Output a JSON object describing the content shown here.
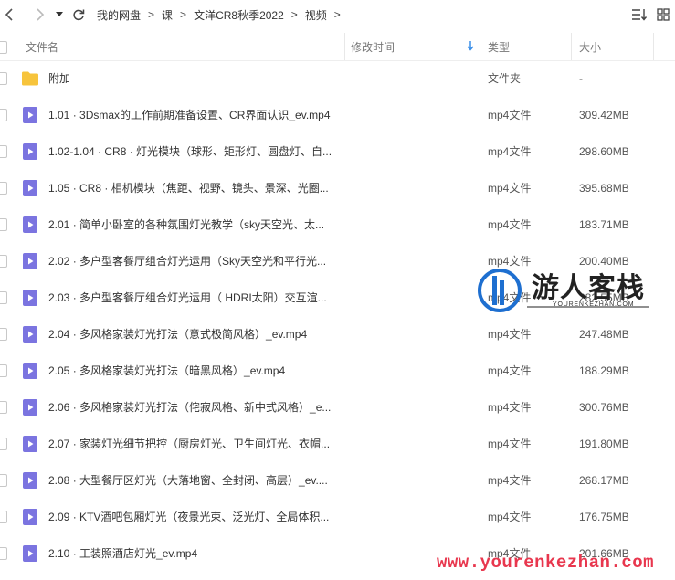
{
  "breadcrumb": [
    "我的网盘",
    "课",
    "文洋CR8秋季2022",
    "视频"
  ],
  "breadcrumb_sep": ">",
  "columns": {
    "name": "文件名",
    "modified": "修改时间",
    "type": "类型",
    "size": "大小"
  },
  "files": [
    {
      "name": "附加",
      "type": "文件夹",
      "size": "-",
      "kind": "folder"
    },
    {
      "name": "1.01 · 3Dsmax的工作前期准备设置、CR界面认识_ev.mp4",
      "type": "mp4文件",
      "size": "309.42MB",
      "kind": "video"
    },
    {
      "name": "1.02-1.04 · CR8 · 灯光模块（球形、矩形灯、圆盘灯、自...",
      "type": "mp4文件",
      "size": "298.60MB",
      "kind": "video"
    },
    {
      "name": "1.05 · CR8 · 相机模块（焦距、视野、镜头、景深、光圈...",
      "type": "mp4文件",
      "size": "395.68MB",
      "kind": "video"
    },
    {
      "name": "2.01 · 简单小卧室的各种氛围灯光教学（sky天空光、太...",
      "type": "mp4文件",
      "size": "183.71MB",
      "kind": "video"
    },
    {
      "name": "2.02 · 多户型客餐厅组合灯光运用（Sky天空光和平行光...",
      "type": "mp4文件",
      "size": "200.40MB",
      "kind": "video"
    },
    {
      "name": "2.03 · 多户型客餐厅组合灯光运用（ HDRI太阳）交互渲...",
      "type": "mp4文件",
      "size": "282.55MB",
      "kind": "video"
    },
    {
      "name": "2.04 · 多风格家装灯光打法（意式极简风格）_ev.mp4",
      "type": "mp4文件",
      "size": "247.48MB",
      "kind": "video"
    },
    {
      "name": "2.05 · 多风格家装灯光打法（暗黑风格）_ev.mp4",
      "type": "mp4文件",
      "size": "188.29MB",
      "kind": "video"
    },
    {
      "name": "2.06 · 多风格家装灯光打法（侘寂风格、新中式风格）_e...",
      "type": "mp4文件",
      "size": "300.76MB",
      "kind": "video"
    },
    {
      "name": "2.07 · 家装灯光细节把控（厨房灯光、卫生间灯光、衣帽...",
      "type": "mp4文件",
      "size": "191.80MB",
      "kind": "video"
    },
    {
      "name": "2.08 · 大型餐厅区灯光（大落地窗、全封闭、高层）_ev....",
      "type": "mp4文件",
      "size": "268.17MB",
      "kind": "video"
    },
    {
      "name": "2.09 · KTV酒吧包厢灯光（夜景光束、泛光灯、全局体积...",
      "type": "mp4文件",
      "size": "176.75MB",
      "kind": "video"
    },
    {
      "name": "2.10 · 工装照酒店灯光_ev.mp4",
      "type": "mp4文件",
      "size": "201.66MB",
      "kind": "video"
    }
  ],
  "watermark": {
    "title": "游人客栈",
    "subtitle": "YOURENKEZHAN.COM",
    "url": "www.yourenkezhan.com"
  },
  "colors": {
    "video_icon": "#7b74e0",
    "folder_icon": "#f7c43c",
    "sort_arrow": "#3b8fe8",
    "watermark_red": "#e8374e"
  }
}
